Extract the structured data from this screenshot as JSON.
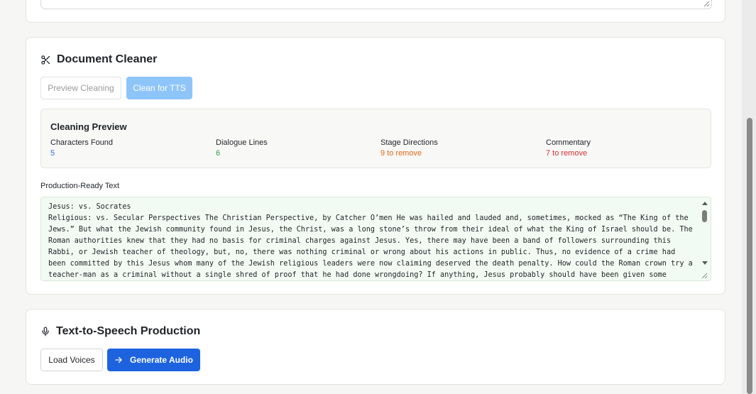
{
  "cleaner": {
    "title": "Document Cleaner",
    "buttons": {
      "preview": "Preview Cleaning",
      "clean": "Clean for TTS"
    },
    "preview": {
      "title": "Cleaning Preview",
      "stats": [
        {
          "label": "Characters Found",
          "value": "5",
          "color": "#2f6fd6"
        },
        {
          "label": "Dialogue Lines",
          "value": "6",
          "color": "#2e9a48"
        },
        {
          "label": "Stage Directions",
          "value": "9 to remove",
          "color": "#e06a14"
        },
        {
          "label": "Commentary",
          "value": "7 to remove",
          "color": "#d32f2f"
        }
      ]
    },
    "output_label": "Production-Ready Text",
    "output_text": "Jesus: vs. Socrates\nReligious: vs. Secular Perspectives The Christian Perspective, by Catcher O’men He was hailed and lauded and, sometimes, mocked as “The King of the Jews.” But what the Jewish community found in Jesus, the Christ, was a long stone’s throw from their ideal of what the King of Israel should be. The Roman authorities knew that they had no basis for criminal charges against Jesus. Yes, there may have been a band of followers surrounding this Rabbi, or Jewish teacher of theology, but, no, there was nothing criminal or wrong about his actions in public. Thus, no evidence of a crime had been committed by this Jesus whom many of the Jewish religious leaders were now claiming deserved the death penalty. How could the Roman crown try a teacher-man as a criminal without a single shred of proof that he had done wrongdoing? If anything, Jesus probably should have been given some"
  },
  "tts": {
    "title": "Text-to-Speech Production",
    "buttons": {
      "load": "Load Voices",
      "generate": "Generate Audio"
    }
  },
  "icons": {
    "cleaner": "scissors-icon",
    "tts": "microphone-icon",
    "generate": "arrow-right-icon"
  }
}
